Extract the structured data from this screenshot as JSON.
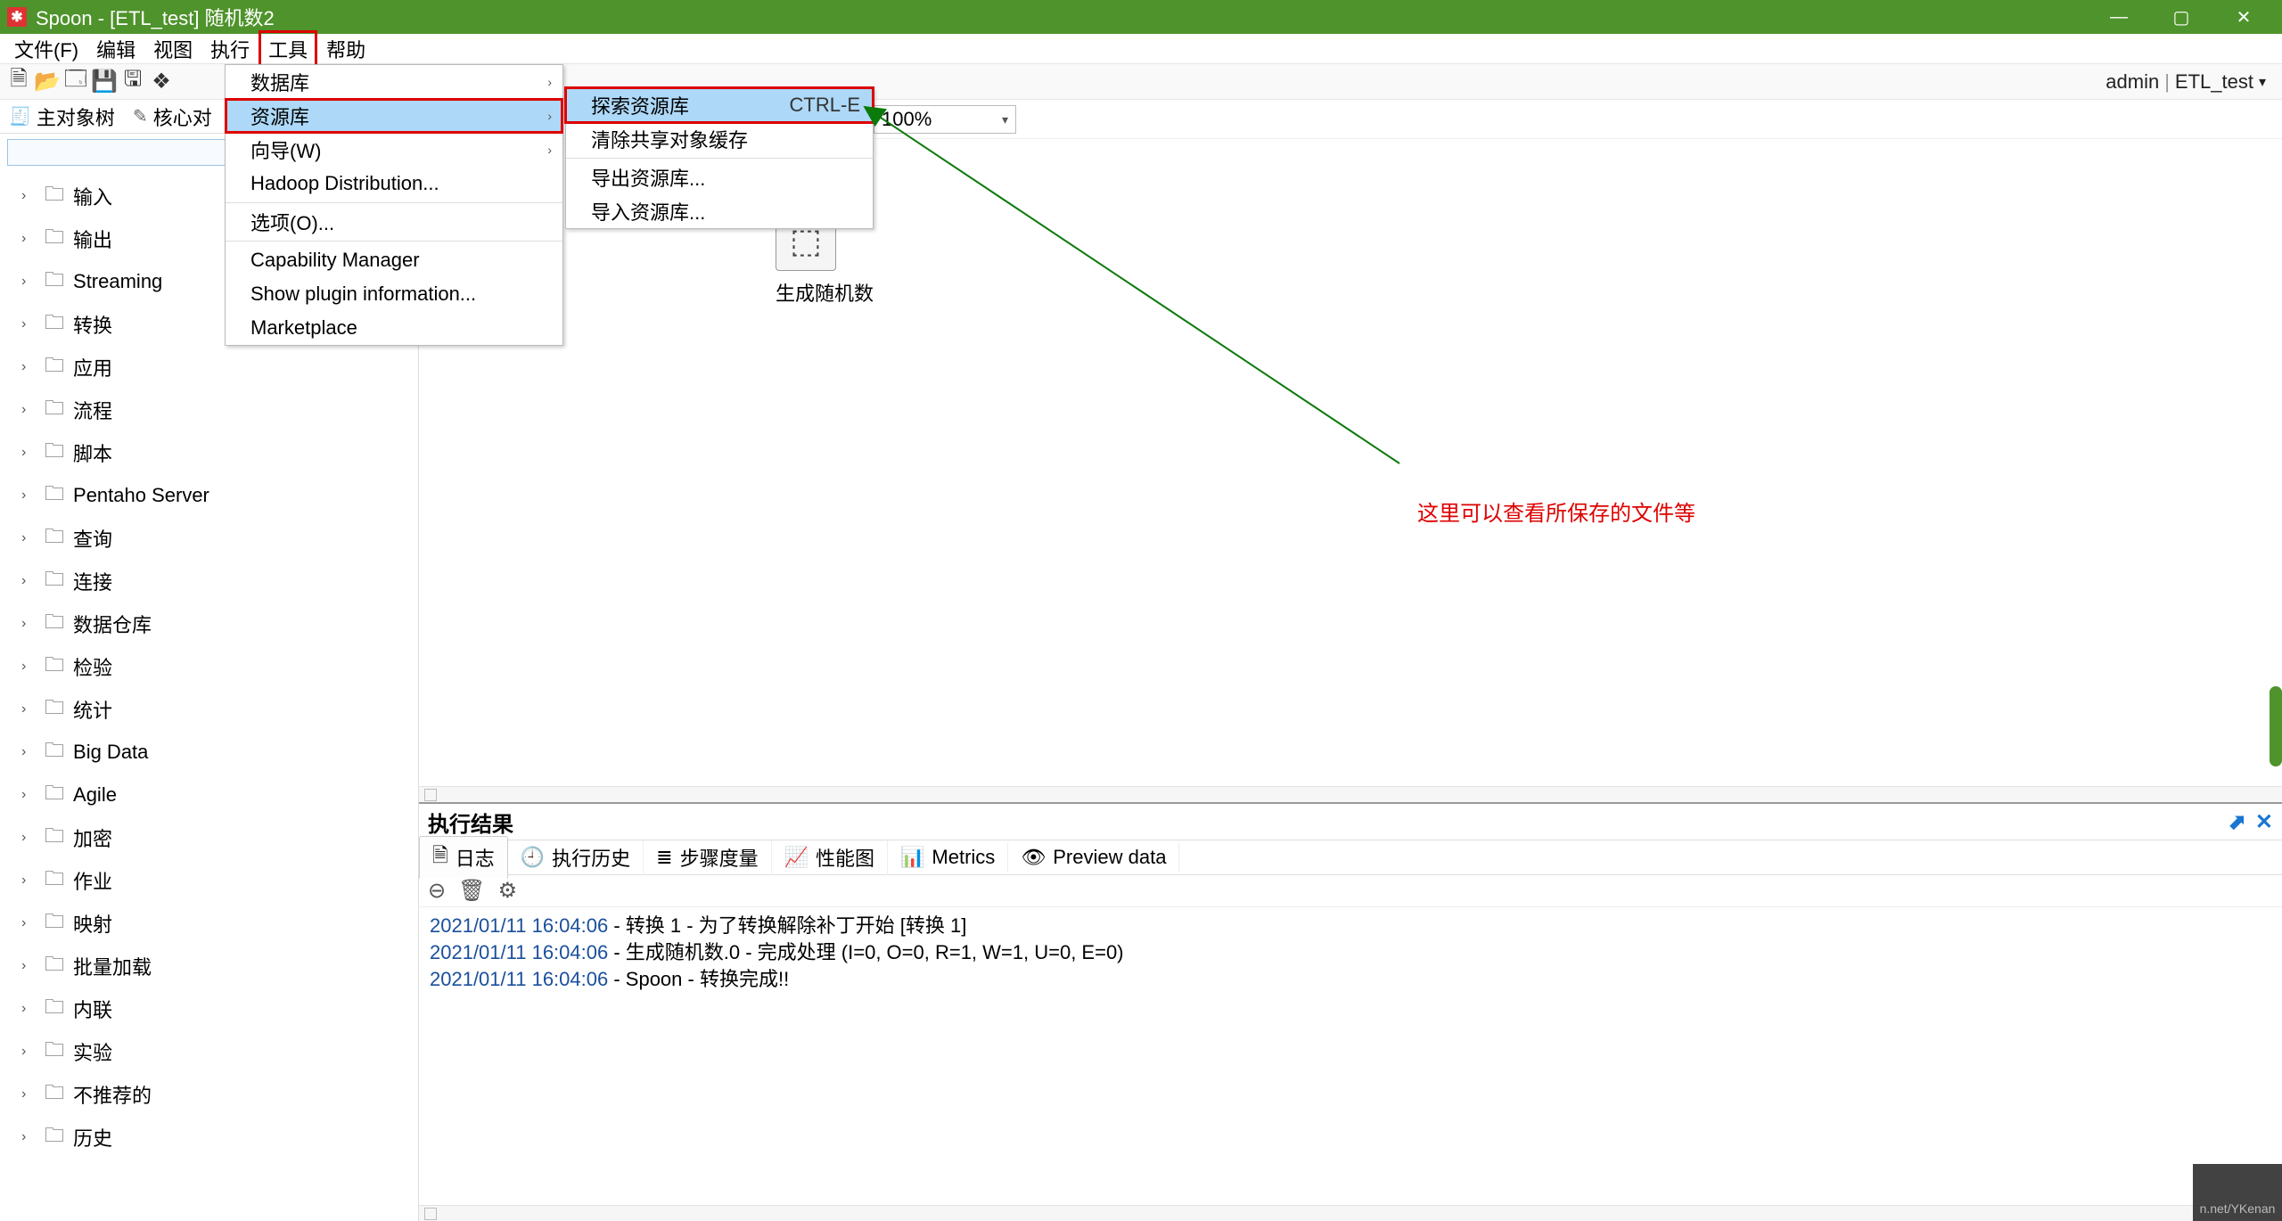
{
  "window": {
    "title": "Spoon - [ETL_test] 随机数2"
  },
  "menubar": {
    "items": [
      "文件(F)",
      "编辑",
      "视图",
      "执行",
      "工具",
      "帮助"
    ]
  },
  "toolbar": {
    "right_user": "admin",
    "right_repo": "ETL_test"
  },
  "dropdown_tools": {
    "items": [
      {
        "label": "数据库",
        "hasSub": true
      },
      {
        "label": "资源库",
        "hasSub": true,
        "hl": true
      },
      {
        "label": "向导(W)",
        "hasSub": true
      },
      {
        "label": "Hadoop Distribution..."
      },
      {
        "label": "选项(O)..."
      },
      {
        "label": "Capability Manager"
      },
      {
        "label": "Show plugin information..."
      },
      {
        "label": "Marketplace"
      }
    ]
  },
  "dropdown_repo": {
    "items": [
      {
        "label": "探索资源库",
        "kbd": "CTRL-E",
        "hl": true
      },
      {
        "label": "清除共享对象缓存"
      },
      {
        "label": "导出资源库..."
      },
      {
        "label": "导入资源库..."
      }
    ]
  },
  "sidebar": {
    "tabs": [
      "主对象树",
      "核心对"
    ],
    "search_placeholder": "",
    "tree": [
      "输入",
      "输出",
      "Streaming",
      "转换",
      "应用",
      "流程",
      "脚本",
      "Pentaho Server",
      "查询",
      "连接",
      "数据仓库",
      "检验",
      "统计",
      "Big Data",
      "Agile",
      "加密",
      "作业",
      "映射",
      "批量加载",
      "内联",
      "实验",
      "不推荐的",
      "历史"
    ]
  },
  "canvas": {
    "zoom": "100%",
    "node_label": "生成随机数",
    "annotation": "这里可以查看所保存的文件等"
  },
  "results": {
    "title": "执行结果",
    "tabs": [
      "日志",
      "执行历史",
      "步骤度量",
      "性能图",
      "Metrics",
      "Preview data"
    ],
    "log": [
      {
        "ts": "2021/01/11 16:04:06",
        "msg": " - 转换 1 - 为了转换解除补丁开始  [转换 1]"
      },
      {
        "ts": "2021/01/11 16:04:06",
        "msg": " - 生成随机数.0 - 完成处理 (I=0, O=0, R=1, W=1, U=0, E=0)"
      },
      {
        "ts": "2021/01/11 16:04:06",
        "msg": " - Spoon - 转换完成!!"
      }
    ]
  },
  "watermark": "n.net/YKenan"
}
